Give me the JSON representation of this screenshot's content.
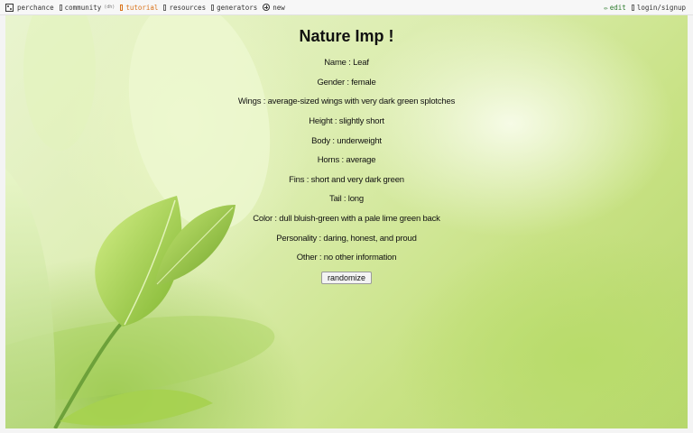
{
  "topbar": {
    "items": [
      {
        "label": "perchance"
      },
      {
        "label": "community",
        "badge": "(dh)"
      },
      {
        "label": "tutorial"
      },
      {
        "label": "resources"
      },
      {
        "label": "generators"
      },
      {
        "label": "new"
      }
    ],
    "edit_label": "edit",
    "login_label": "login/signup"
  },
  "generator": {
    "title": "Nature Imp !",
    "fields": [
      "Name : Leaf",
      "Gender : female",
      "Wings : average-sized wings with very dark green splotches",
      "Height : slightly short",
      "Body : underweight",
      "Horns : average",
      "Fins : short and very dark green",
      "Tail : long",
      "Color : dull bluish-green with a pale lime green back",
      "Personality : daring, honest, and proud",
      "Other : no other information"
    ],
    "button_label": "randomize"
  },
  "colors": {
    "tutorial": "#d9731b",
    "edit": "#2a7a2a",
    "leaf": "#8cc43c"
  }
}
